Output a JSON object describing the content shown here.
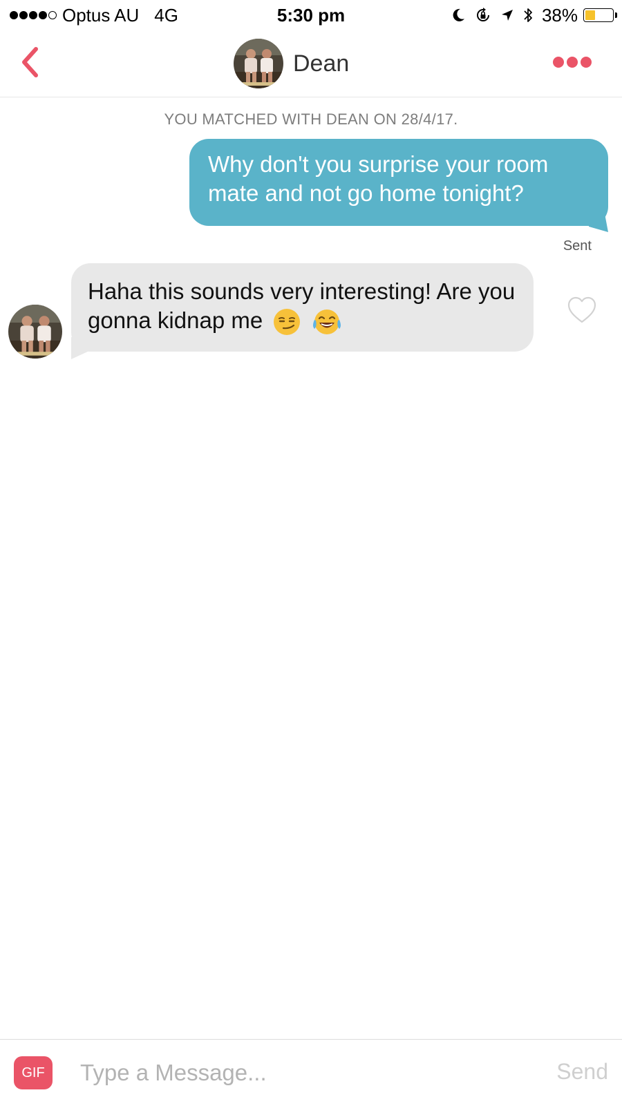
{
  "status_bar": {
    "carrier": "Optus AU",
    "network": "4G",
    "time": "5:30 pm",
    "battery_percent": "38%",
    "battery_level": 0.38,
    "signal_bars": 4,
    "signal_total": 5,
    "icons": [
      "moon-icon",
      "rotation-lock-icon",
      "location-arrow-icon",
      "bluetooth-icon",
      "battery-icon"
    ]
  },
  "header": {
    "title": "Dean",
    "back_icon": "chevron-left-icon",
    "more_icon": "more-dots-icon"
  },
  "conversation": {
    "match_notice": "YOU MATCHED WITH DEAN ON 28/4/17.",
    "messages": [
      {
        "direction": "outgoing",
        "text": "Why don't you surprise your room mate and not go home tonight?",
        "status": "Sent"
      },
      {
        "direction": "incoming",
        "text": "Haha this sounds very interesting! Are you gonna kidnap me",
        "emojis": [
          "smirk-emoji",
          "tears-of-joy-emoji"
        ],
        "liked": false
      }
    ]
  },
  "composer": {
    "gif_label": "GIF",
    "placeholder": "Type a Message...",
    "send_label": "Send"
  },
  "colors": {
    "accent": "#ea5467",
    "outgoing_bubble": "#5ab3c9",
    "incoming_bubble": "#e8e8e8",
    "muted_text": "#7d7d7d",
    "battery": "#f6c22b"
  }
}
